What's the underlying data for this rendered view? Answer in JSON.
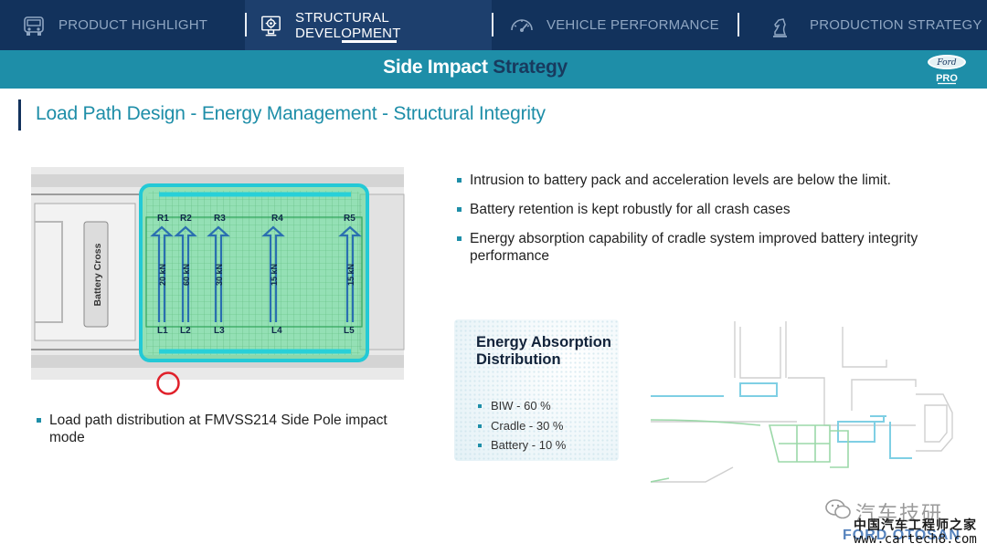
{
  "nav": {
    "tabs": [
      {
        "label": "PRODUCT HIGHLIGHT",
        "icon": "truck-icon",
        "active": false
      },
      {
        "label": "STRUCTURAL DEVELOPMENT",
        "icon": "gear-monitor-icon",
        "active": true
      },
      {
        "label": "VEHICLE PERFORMANCE",
        "icon": "speedometer-icon",
        "active": false
      },
      {
        "label": "PRODUCTION STRATEGY",
        "icon": "chess-knight-icon",
        "active": false
      }
    ]
  },
  "band": {
    "title_light": "Side Impact",
    "title_dark": "Strategy",
    "logo_top": "Ford",
    "logo_bottom": "PRO"
  },
  "heading": "Load Path Design - Energy Management - Structural Integrity",
  "figure": {
    "battery_cross": "Battery Cross",
    "top_labels": [
      "R1",
      "R2",
      "R3",
      "R4",
      "R5"
    ],
    "bottom_labels": [
      "L1",
      "L2",
      "L3",
      "L4",
      "L5"
    ],
    "forces": [
      "20 kN",
      "60 kN",
      "30 kN",
      "15 kN",
      "15 kN"
    ]
  },
  "bullets": [
    "Intrusion to battery pack and acceleration levels are below the limit.",
    "Battery retention is kept robustly for all crash cases",
    "Energy absorption capability of cradle system improved battery integrity performance"
  ],
  "caption": "Load path distribution at FMVSS214 Side Pole impact mode",
  "energy_card": {
    "title": "Energy Absorption Distribution",
    "items": [
      "BIW - 60 %",
      "Cradle - 30 %",
      "Battery - 10 %"
    ]
  },
  "watermark": {
    "cn_title": "汽车技研",
    "cn_sub": "中国汽车工程师之家",
    "ford": "FORD OTOSAN",
    "url": "www.cartech8.com"
  },
  "colors": {
    "nav_bg": "#12325c",
    "accent_teal": "#1e8ea8",
    "battery_green": "#3fcf6a",
    "battery_cyan": "#2ee0e0"
  }
}
